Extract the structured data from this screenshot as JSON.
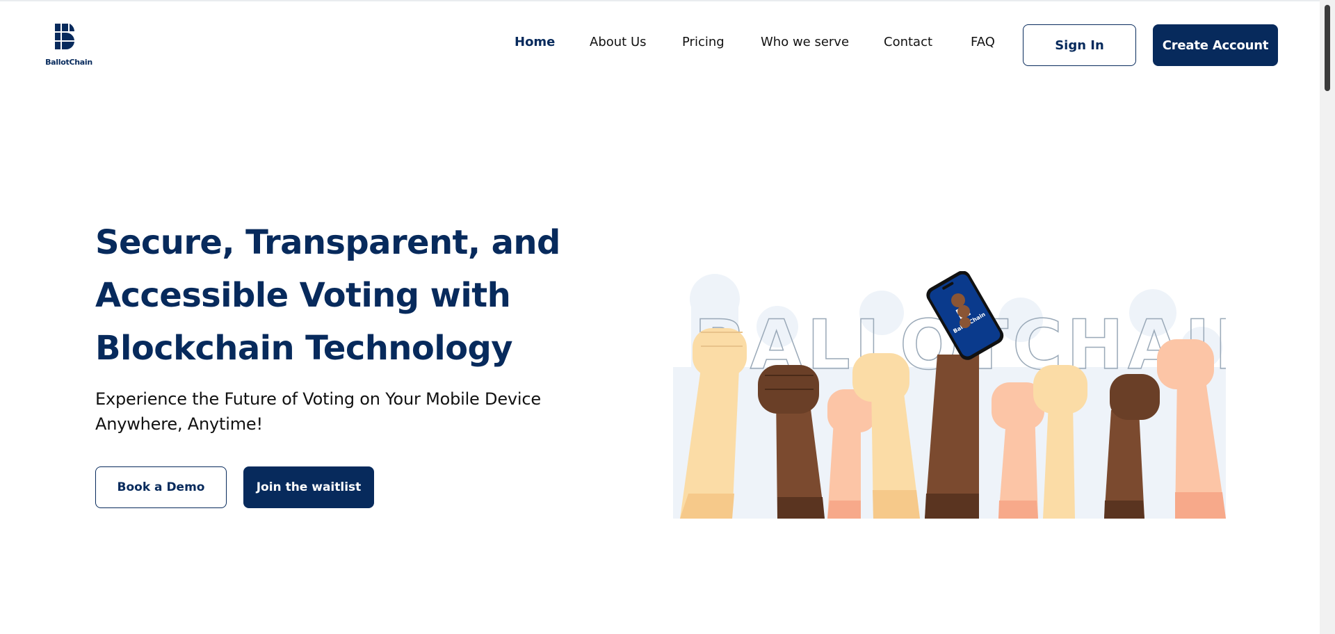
{
  "brand": {
    "name": "BallotChain",
    "primary_color": "#072a5c"
  },
  "nav": {
    "items": [
      {
        "label": "Home",
        "active": true
      },
      {
        "label": "About Us",
        "active": false
      },
      {
        "label": "Pricing",
        "active": false
      },
      {
        "label": "Who we serve",
        "active": false
      },
      {
        "label": "Contact",
        "active": false
      },
      {
        "label": "FAQ",
        "active": false
      }
    ],
    "sign_in_label": "Sign In",
    "create_account_label": "Create Account"
  },
  "hero": {
    "title_lines": [
      "Secure, Transparent, and",
      "Accessible Voting with",
      "Blockchain Technology"
    ],
    "subtitle_lines": [
      "Experience the Future of Voting on Your Mobile Device",
      "Anywhere, Anytime!"
    ],
    "book_demo_label": "Book a Demo",
    "waitlist_label": "Join the waitlist"
  },
  "illustration": {
    "background_word": "BALLOTCHAIN",
    "phone_brand": "BallotChain",
    "icon": "raised-fists-with-phone-illustration"
  }
}
